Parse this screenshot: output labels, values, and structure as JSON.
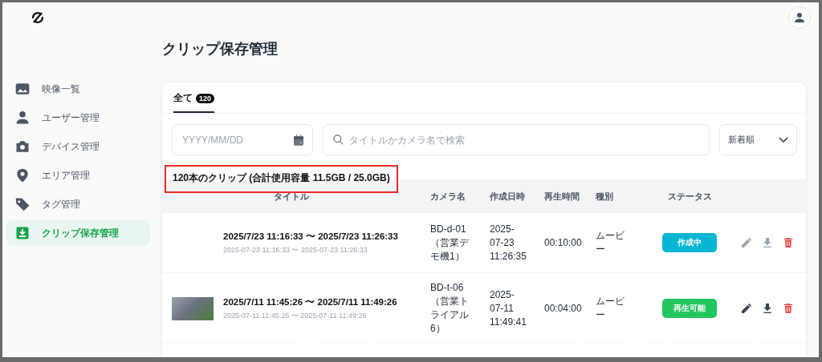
{
  "page_title": "クリップ保存管理",
  "sidebar": {
    "items": [
      {
        "label": "映像一覧",
        "kind": "image",
        "selected": false
      },
      {
        "label": "ユーザー管理",
        "kind": "user",
        "selected": false
      },
      {
        "label": "デバイス管理",
        "kind": "camera",
        "selected": false
      },
      {
        "label": "エリア管理",
        "kind": "pin",
        "selected": false
      },
      {
        "label": "タグ管理",
        "kind": "tag",
        "selected": false
      },
      {
        "label": "クリップ保存管理",
        "kind": "clip",
        "selected": true
      }
    ]
  },
  "tabs": [
    {
      "label": "全て",
      "count": "120",
      "selected": true
    }
  ],
  "filters": {
    "date": {
      "placeholder": "YYYY/MM/DD"
    },
    "search": {
      "placeholder": "タイトルかカメラ名で検索"
    },
    "sort": {
      "value": "新着順"
    }
  },
  "summary": "120本のクリップ (合計使用容量 11.5GB / 25.0GB)",
  "table": {
    "columns": [
      "タイトル",
      "カメラ名",
      "作成日時",
      "再生時間",
      "種別",
      "ステータス"
    ],
    "rows": [
      {
        "thumbnail": false,
        "title": "2025/7/23 11:16:33 〜 2025/7/23 11:26:33",
        "subtitle": "2025-07-23 11:16:33 〜 2025-07-23 11:26:33",
        "camera": "BD-d-01（営業デモ機1）",
        "created": "2025-07-23 11:26:35",
        "duration": "00:10:00",
        "type": "ムービー",
        "status": {
          "label": "作成中",
          "color": "#06b6d4"
        },
        "actions_disabled": true
      },
      {
        "thumbnail": true,
        "title": "2025/7/11 11:45:26 〜 2025/7/11 11:49:26",
        "subtitle": "2025-07-11 11:45:26 〜 2025-07-11 11:49:26",
        "camera": "BD-t-06（営業トライアル6）",
        "created": "2025-07-11 11:49:41",
        "duration": "00:04:00",
        "type": "ムービー",
        "status": {
          "label": "再生可能",
          "color": "#22c55e"
        },
        "actions_disabled": false
      }
    ]
  }
}
